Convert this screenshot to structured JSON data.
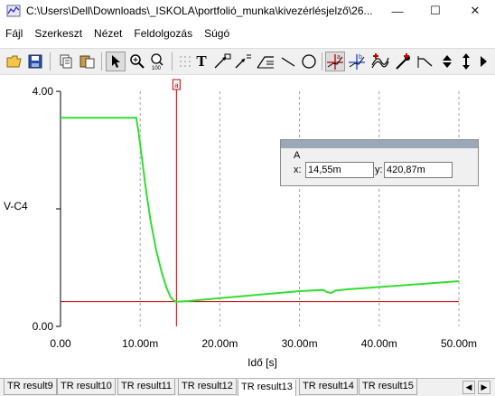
{
  "window": {
    "title": "C:\\Users\\Dell\\Downloads\\_ISKOLA\\portfolió_munka\\kivezérlésjelző\\26...",
    "minimize": "—",
    "maximize": "☐",
    "close": "✕"
  },
  "menu": [
    "Fájl",
    "Szerkeszt",
    "Nézet",
    "Feldolgozás",
    "Súgó"
  ],
  "toolbar": {
    "icons": [
      "open-folder-icon",
      "save-disk-icon",
      "copy-icon",
      "paste-icon",
      "pointer-icon",
      "zoom-in-icon",
      "zoom-100-icon",
      "grid-icon",
      "text-tool-icon",
      "arrow-label-icon",
      "arrow-label-2-icon",
      "slope-label-icon",
      "line-tool-icon",
      "circle-tool-icon",
      "cursor-a-icon",
      "cursor-b-icon",
      "curve-icon",
      "probe-icon",
      "step-icon",
      "up-down-arrows-icon"
    ],
    "cursor_a_label": "a",
    "cursor_b_label": "b",
    "text_tool_label": "T"
  },
  "cursor_marker": "a",
  "readout": {
    "name": "A",
    "x_label": "x:",
    "y_label": "y:",
    "x_value": "14,55m",
    "y_value": "420,87m"
  },
  "colors": {
    "trace": "#33dd33",
    "cursor": "#c00000",
    "grid": "#a0a0a0"
  },
  "chart_data": {
    "type": "line",
    "title": "",
    "xlabel": "Idő [s]",
    "ylabel": "V-C4",
    "xlim": [
      0,
      0.05
    ],
    "ylim": [
      0,
      4
    ],
    "y_tick_labels": [
      "4.00",
      "0.00"
    ],
    "x_tick_labels": [
      "0.00",
      "10.00m",
      "20.00m",
      "30.00m",
      "40.00m",
      "50.00m"
    ],
    "x_ticks": [
      0,
      0.01,
      0.02,
      0.03,
      0.04,
      0.05
    ],
    "y_ticks": [
      0,
      4
    ],
    "grid": true,
    "cursor_a": {
      "x": 0.01455,
      "y": 0.42087
    },
    "series": [
      {
        "x": [
          0,
          0.0095,
          0.0098,
          0.0102,
          0.0107,
          0.0113,
          0.012,
          0.0127,
          0.0133,
          0.0138,
          0.0142,
          0.01455,
          0.016,
          0.02,
          0.025,
          0.03,
          0.033,
          0.0335,
          0.034,
          0.0345,
          0.036,
          0.04,
          0.045,
          0.05
        ],
        "y": [
          3.55,
          3.55,
          3.3,
          2.88,
          2.35,
          1.8,
          1.3,
          0.92,
          0.66,
          0.5,
          0.44,
          0.42,
          0.43,
          0.48,
          0.54,
          0.6,
          0.62,
          0.58,
          0.57,
          0.61,
          0.63,
          0.67,
          0.72,
          0.77
        ]
      }
    ]
  },
  "tabs": [
    {
      "label": "TR result9",
      "active": false
    },
    {
      "label": "TR result10",
      "active": false
    },
    {
      "label": "TR result11",
      "active": false
    },
    {
      "label": "TR result12",
      "active": false
    },
    {
      "label": "TR result13",
      "active": true
    },
    {
      "label": "TR result14",
      "active": false
    },
    {
      "label": "TR result15",
      "active": false
    }
  ],
  "tab_scroll": {
    "left": "◀",
    "right": "▶"
  }
}
